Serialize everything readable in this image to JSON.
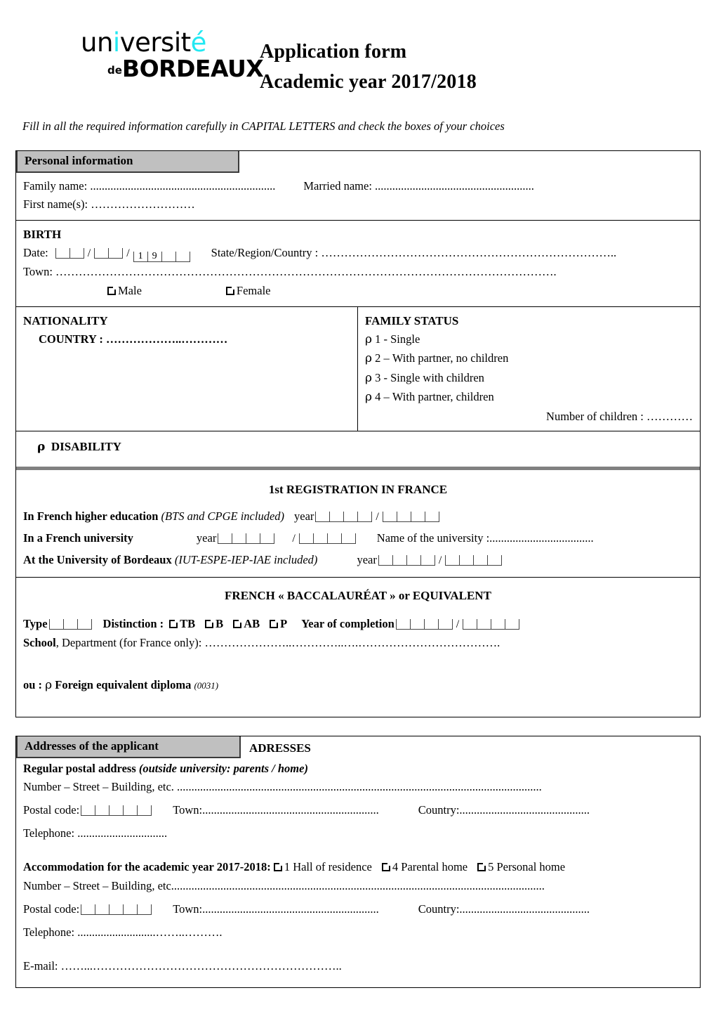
{
  "header": {
    "logo": {
      "line1_black_1": "un",
      "line1_cyan": "i",
      "line1_black_2": "versit",
      "line1_cyan_2": "é",
      "de": "de",
      "bordeaux": "BORDEAUX"
    },
    "title_line1": "Application form",
    "title_line2": "Academic year 2017/2018"
  },
  "instruction": "Fill in all the required information carefully in CAPITAL LETTERS and check the boxes of your choices",
  "personal": {
    "header_label": "Personal information",
    "family_name_label": "Family name: ................................................................",
    "married_name_label": "Married name: .......................................................",
    "first_names_label": "First name(s): ………………………"
  },
  "birth": {
    "title": "BIRTH",
    "date_label": "Date:",
    "year_prefill_1": "1",
    "year_prefill_2": "9",
    "state_region_country_label": "State/Region/Country : …………………………………………………………………..",
    "town_label": "Town: ………………………………………………………………………………………………………………….",
    "male_label": "Male",
    "female_label": "Female"
  },
  "nationality": {
    "title": "NATIONALITY",
    "country_label": "COUNTRY : ………………..…………"
  },
  "family_status": {
    "title": "FAMILY STATUS",
    "options": [
      "1 - Single",
      "2 – With partner, no children",
      "3 - Single with children",
      "4 – With partner, children"
    ],
    "number_of_children_label": "Number of children : …………"
  },
  "disability": {
    "label": "DISABILITY"
  },
  "registration": {
    "title": "1st REGISTRATION IN FRANCE",
    "rows": [
      {
        "bold": "In French higher education",
        "italic": "(BTS and CPGE included)",
        "year_label": "year"
      },
      {
        "bold": "In a French university",
        "italic": "",
        "year_label": "year",
        "university_label": "Name of the university :...................................."
      },
      {
        "bold": "At the University of Bordeaux",
        "italic": "(IUT-ESPE-IEP-IAE included)",
        "year_label": "year"
      }
    ]
  },
  "baccalaureat": {
    "title": "FRENCH « BACCALAURÉAT » or EQUIVALENT",
    "type_label": "Type",
    "distinction_label": "Distinction :",
    "distinction_options": [
      "TB",
      "B",
      "AB",
      "P"
    ],
    "year_of_completion_label": "Year of completion",
    "school_label_bold": "School",
    "school_label_rest": ", Department (for France only): …………………..…………..….……………………………….",
    "foreign_prefix": "ou :",
    "foreign_label": "Foreign equivalent diploma",
    "foreign_code": "(0031)"
  },
  "addresses": {
    "header_label": "Addresses of the applicant",
    "header_after": "ADRESSES",
    "regular_bold": "Regular postal address",
    "regular_italic": "(outside university: parents / home)",
    "number_street_1": "Number – Street – Building, etc. ..............................................................................................................................",
    "postal_code_label": "Postal code:",
    "town_label_1": "Town:.............................................................",
    "country_label_1": "Country:.............................................",
    "telephone_1": "Telephone: ...............................",
    "accommodation_bold": "Accommodation for the academic year 2017-2018:",
    "accommodation_options": [
      "1 Hall of residence",
      "4 Parental home",
      "5 Personal home"
    ],
    "number_street_2": "Number – Street – Building, etc.................................................................................................................................",
    "town_label_2": "Town:.............................................................",
    "country_label_2": "Country:.............................................",
    "telephone_2": "Telephone: ...........................……..……….",
    "email_label": "E-mail: ……...……………………………………………………….."
  },
  "colors": {
    "logo_cyan": "#22E8F2",
    "header_gray": "#c0c0c0",
    "divider_gray": "#808080",
    "text": "#000000"
  }
}
